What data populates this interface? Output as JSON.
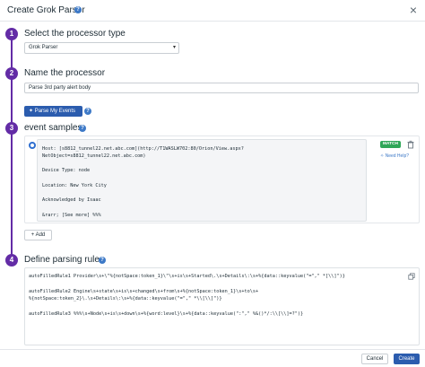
{
  "dialog": {
    "title": "Create Grok Parser",
    "close_glyph": "×"
  },
  "steps": [
    {
      "number": "1",
      "title": "Select the processor type"
    },
    {
      "number": "2",
      "title": "Name the processor"
    },
    {
      "number": "3",
      "title": "event samples"
    },
    {
      "number": "4",
      "title": "Define parsing rules"
    }
  ],
  "processor_type": {
    "value": "Grok Parser",
    "caret": "▾"
  },
  "processor_name": {
    "value": "Parse 3rd party alert body"
  },
  "parse_button": {
    "label": "Parse My Events"
  },
  "sample": {
    "lines": [
      "Host: [s8812_tunnel22.net.abc.com](http://T1WASLW702:80/Orion/View.aspx?",
      "NetObject=s8812_tunnel22.net.abc.com)",
      "Device Type: node",
      "Location: New York City",
      "Acknowledged by Isaac",
      "&rarr; [See more] %%%"
    ],
    "match_label": "MATCH",
    "need_help": "Need Help?"
  },
  "add_button": {
    "label": "Add",
    "icon": "+"
  },
  "rules": [
    {
      "parts": [
        {
          "text": "autoFilledRule1 Provider\\s+\\\"%{notSpace:token_1}\\\"\\s+is\\s+Started\\.\\s+Details\\:\\s+%{data::keyvalue(\"=\",\" *[\\\\]\")}",
          "green": false
        }
      ]
    },
    {
      "parts": [
        {
          "text": "autoFilledRule2 Engine\\s+state\\s+is\\s+changed\\s+from\\s+%{notSpace:token_1}\\s+to\\s+",
          "green": false
        },
        {
          "text": "%{notSpace:token_2}\\.\\s+Details\\:\\s+%{data::keyvalue(\"=\",\" *\\\\[\\\\]\")}",
          "green": false
        }
      ]
    },
    {
      "parts": [
        {
          "text": "autoFilledRule3 %%%\\s+Node\\s+is\\s+down\\s+%{word:level}\\s+%{data::keyvalue(\":\",\" %&()*/:\\\\[\\\\]=?\")}",
          "green": false
        }
      ]
    }
  ],
  "footer": {
    "cancel": "Cancel",
    "create": "Create"
  },
  "colors": {
    "accent": "#632ca6",
    "primary": "#2b5cae",
    "match": "#2fa657",
    "link": "#3d79c7"
  }
}
